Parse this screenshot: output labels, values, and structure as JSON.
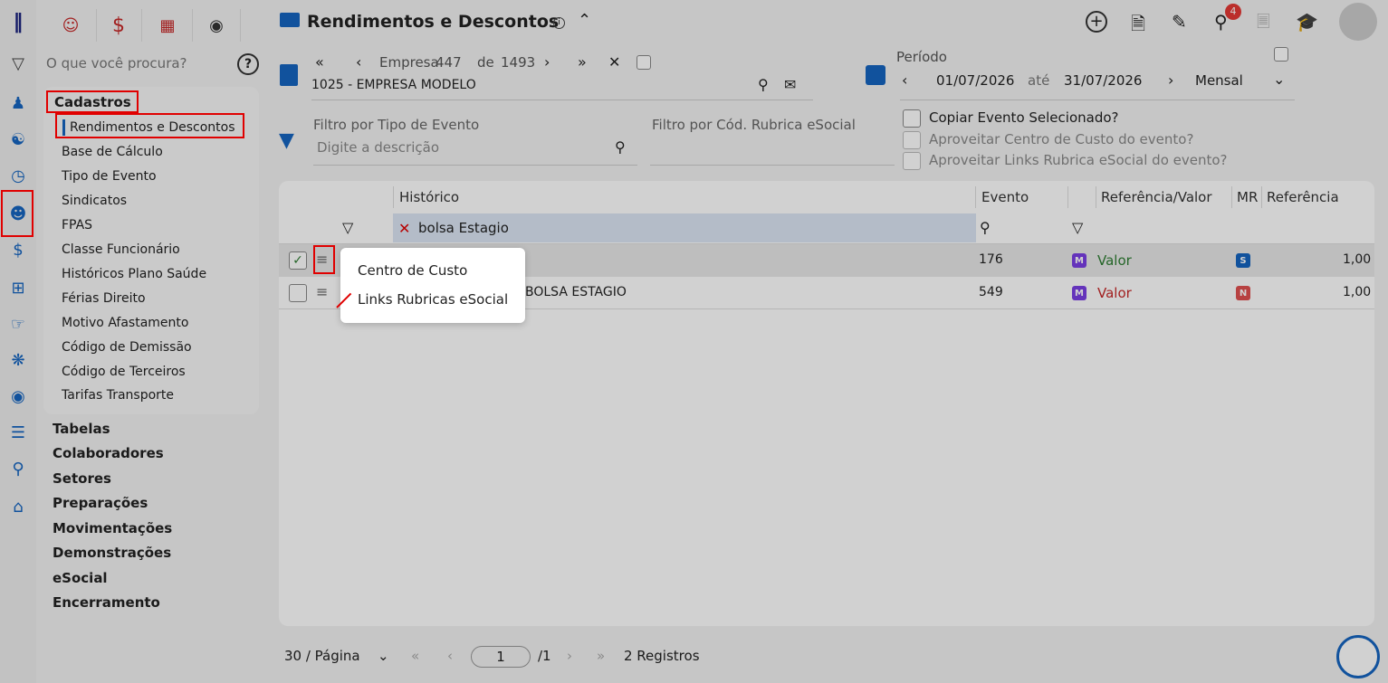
{
  "app": {
    "title": "Rendimentos e Descontos"
  },
  "search": {
    "placeholder": "O que você procura?"
  },
  "menu": {
    "section": "Cadastros",
    "sub_items": [
      "Rendimentos e Descontos",
      "Base de Cálculo",
      "Tipo de Evento",
      "Sindicatos",
      "FPAS",
      "Classe Funcionário",
      "Históricos Plano Saúde",
      "Férias Direito",
      "Motivo Afastamento",
      "Código de Demissão",
      "Código de Terceiros",
      "Tarifas Transporte"
    ],
    "main_items": [
      "Tabelas",
      "Colaboradores",
      "Setores",
      "Preparações",
      "Movimentações",
      "Demonstrações",
      "eSocial",
      "Encerramento"
    ]
  },
  "company": {
    "label": "Empresa",
    "current": "447",
    "of": "de",
    "total": "1493",
    "name": "1025 - EMPRESA MODELO"
  },
  "period": {
    "label": "Período",
    "start": "01/07/2026",
    "until": "até",
    "end": "31/07/2026",
    "mode": "Mensal"
  },
  "filters": {
    "event_type_label": "Filtro por Tipo de Evento",
    "event_type_placeholder": "Digite a descrição",
    "rubrica_label": "Filtro por Cód. Rubrica eSocial",
    "copy_event": "Copiar Evento Selecionado?",
    "reuse_cost_center": "Aproveitar Centro de Custo do evento?",
    "reuse_links": "Aproveitar Links Rubrica eSocial do evento?"
  },
  "notifications": {
    "count": "4"
  },
  "grid": {
    "headers": {
      "historico": "Histórico",
      "evento": "Evento",
      "ref_valor": "Referência/Valor",
      "mr": "MR",
      "referencia": "Referência"
    },
    "filter_text": "bolsa Estagio",
    "rows": [
      {
        "historico": "",
        "evento": "176",
        "m": "M",
        "tipo": "Valor",
        "mr": "S",
        "referencia": "1,00",
        "checked": true
      },
      {
        "historico": "BOLSA ESTAGIO",
        "evento": "549",
        "m": "M",
        "tipo": "Valor",
        "mr": "N",
        "referencia": "1,00",
        "checked": false
      }
    ]
  },
  "context_menu": {
    "items": [
      "Centro de Custo",
      "Links Rubricas eSocial"
    ]
  },
  "pager": {
    "per_page": "30 / Página",
    "page": "1",
    "of": "/1",
    "records": "2 Registros"
  },
  "colors": {
    "accent": "#1565c0",
    "red": "#e00000",
    "valor_green": "#2e7d32",
    "valor_red": "#c62828",
    "badge_m": "#7b3fe4",
    "badge_s": "#1565c0",
    "badge_n": "#e05050"
  }
}
